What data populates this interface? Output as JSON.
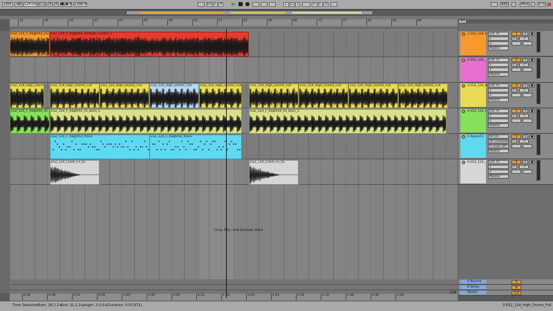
{
  "transport": {
    "link": "Link",
    "tap": "Tap",
    "tempo": "124.00",
    "nudge": "||| |||",
    "sig_num": "4",
    "sig_den": "4",
    "metronome": "●",
    "follow": "◆ ▾",
    "quantize": "1 Bar ▾",
    "position": [
      "32.",
      "2.",
      "4"
    ],
    "loop_start": [
      "1.",
      "1.",
      "1"
    ],
    "loop_len": [
      "0.",
      "1.",
      "0"
    ],
    "key": "Key",
    "midi": "MIDI",
    "cpu": "0 %"
  },
  "ruler": {
    "bars": [
      "25",
      "29",
      "33",
      "37",
      "41",
      "45",
      "49",
      "53",
      "57",
      "61",
      "65",
      "69",
      "73",
      "77",
      "81",
      "85",
      "89"
    ],
    "end_label": "Set"
  },
  "timecodes": [
    "0:46",
    "0:48",
    "0:52",
    "0:56",
    "1:00",
    "1:04",
    "1:08",
    "1:12",
    "1:16",
    "1:20",
    "1:24",
    "1:28",
    "1:32",
    "1:36",
    "1:40",
    "1:44"
  ],
  "tracks": [
    {
      "name": "1 ES2_124_F",
      "color": "#f79a2d",
      "input": "Ext. In",
      "ch": "1",
      "num": "1",
      "out": "Master",
      "sub": "2"
    },
    {
      "name": "2 ES2_124_",
      "color": "#e76fd0",
      "input": "Ext. In",
      "ch": "2",
      "num": "2",
      "out": "Master",
      "sub": "2"
    },
    {
      "name": "3 ES2_124_H",
      "color": "#e8dc57",
      "input": "Ext. In",
      "ch": "1",
      "num": "3",
      "out": "Master",
      "sub": "2"
    },
    {
      "name": "4 ES2_124_F",
      "color": "#86e05a",
      "input": "Ext. In",
      "ch": "1",
      "num": "4",
      "out": "Master",
      "sub": "2"
    },
    {
      "name": "5 Xpand!2",
      "color": "#5fd9f0",
      "input": "All Ins",
      "ch": "All Channels",
      "num": "5",
      "out": "Master",
      "sub": "In Auto Off"
    },
    {
      "name": "6 ES2_124_",
      "color": "#d6d6d6",
      "input": "Ext. In",
      "ch": "1",
      "num": "6",
      "out": "Master",
      "sub": "2"
    }
  ],
  "returns": [
    {
      "name": "A Reverb",
      "color": "#7fa8e8",
      "num": "A"
    },
    {
      "name": "B Delay",
      "color": "#7fa8e8",
      "num": "B"
    },
    {
      "name": "Master",
      "color": "#7fa8e8",
      "num": "1/2"
    }
  ],
  "clips": [
    {
      "lane": 0,
      "name": "ES2_124_F_Ragtime_ES2",
      "color": "#f79a2d"
    },
    {
      "lane": 0,
      "name": "ES2_124_F_Ragtime_Vintage_Combo_2",
      "color": "#e83b30"
    },
    {
      "lane": 2,
      "name": "ES2_124_High_Drums_Full",
      "color": "#e8dc57"
    },
    {
      "lane": 2,
      "name": "ES2_124_High_Drums_Full",
      "color": "#e8dc57"
    },
    {
      "lane": 2,
      "name": "ES2_124_High_Drums_Full",
      "color": "#e8dc57"
    },
    {
      "lane": 2,
      "name": "ES2_124_High_Drums_Full",
      "color": "#b7d9f0"
    },
    {
      "lane": 2,
      "name": "ES2_124_High_Drums_Full",
      "color": "#e8dc57"
    },
    {
      "lane": 2,
      "name": "ES2_124_High_Drums_Full",
      "color": "#e8dc57"
    },
    {
      "lane": 2,
      "name": "ES2_124_High_Drums_Full",
      "color": "#e8dc57"
    },
    {
      "lane": 2,
      "name": "ES2_124_High_Drums_Full",
      "color": "#e8dc57"
    },
    {
      "lane": 2,
      "name": "ES2_124_High_Drums_Full",
      "color": "#e8dc57"
    },
    {
      "lane": 3,
      "name": "ES2_124_F_Ragtime_Ac",
      "color": "#86e05a"
    },
    {
      "lane": 3,
      "name": "ES2_124_F_Ragtime_Ac_Bass_1",
      "color": "#d9e08a"
    },
    {
      "lane": 3,
      "name": "ES2_124_F_Ragtime_Ac_Bass_1",
      "color": "#d9e08a"
    },
    {
      "lane": 4,
      "name": "ES2_124_F_Ragtime_Piano",
      "color": "#5fd9f0"
    },
    {
      "lane": 4,
      "name": "ES2_124_F_Ragtime_Piano",
      "color": "#5fd9f0"
    },
    {
      "lane": 5,
      "name": "ES2_124_Crash_Fx_01",
      "color": "#d6d6d6"
    },
    {
      "lane": 5,
      "name": "ES2_124_Crash_Fx_01",
      "color": "#d6d6d6"
    }
  ],
  "drop_hint": "Drop Files and Devices Here",
  "status": {
    "mode": "Time Selection",
    "start": "Start: 28.1.1+",
    "end": "End: 31.1.1+",
    "length": "Length: 2.0.0+",
    "duration": "(Duration: 0:03.871)",
    "page": "1/4",
    "track_label": "3-ES2_124_High_Drums_Full"
  }
}
